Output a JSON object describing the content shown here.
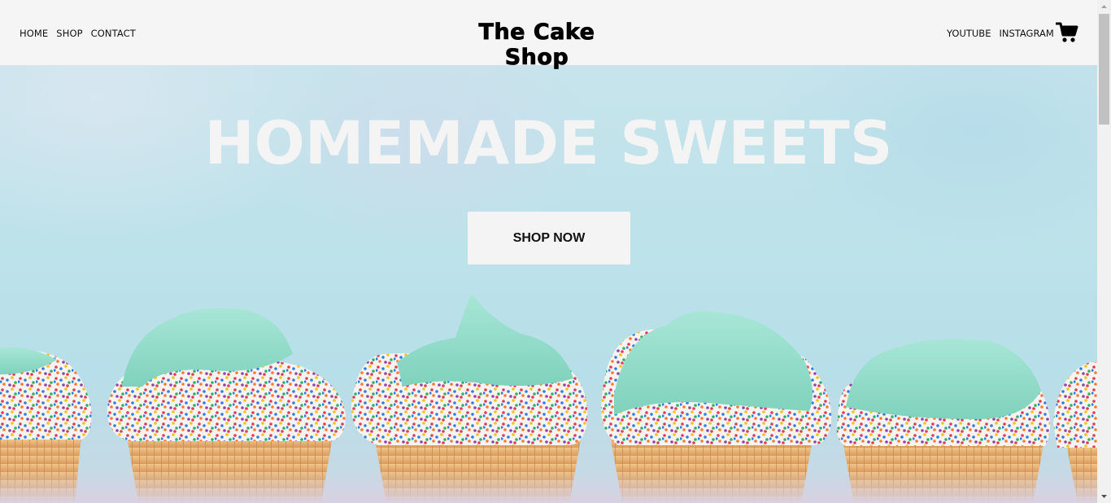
{
  "header": {
    "nav_left": [
      {
        "label": "HOME"
      },
      {
        "label": "SHOP"
      },
      {
        "label": "CONTACT"
      }
    ],
    "logo": "The Cake Shop",
    "nav_right": [
      {
        "label": "YOUTUBE"
      },
      {
        "label": "INSTAGRAM"
      }
    ],
    "cart_icon": "shopping-cart-icon"
  },
  "hero": {
    "title": "HOMEMADE SWEETS",
    "cta_label": "SHOP NOW",
    "image_subject": "row of cupcakes with mint frosting and rainbow sprinkles"
  },
  "colors": {
    "header_bg": "#f5f5f5",
    "hero_sky": "#bde2ea",
    "frosting": "#8fdcc8",
    "cake": "#e8b77a",
    "button_bg": "#f4f4f4",
    "title_text": "#f4f4f4"
  }
}
